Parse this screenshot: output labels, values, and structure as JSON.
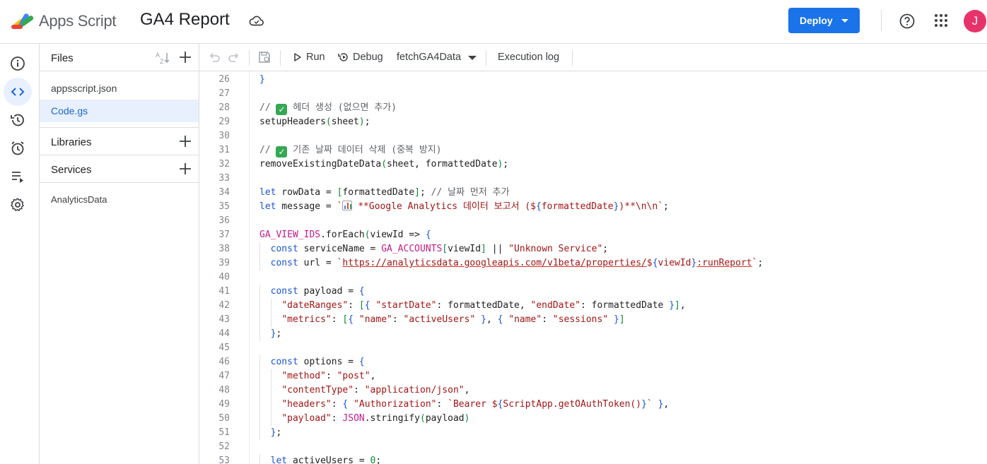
{
  "header": {
    "app_name": "Apps Script",
    "project_name": "GA4 Report",
    "deploy_label": "Deploy",
    "avatar_letter": "J"
  },
  "rail": {
    "items": [
      "overview",
      "editor",
      "executions-history",
      "triggers",
      "executions",
      "project-settings"
    ]
  },
  "files_panel": {
    "files_title": "Files",
    "files": [
      {
        "name": "appsscript.json",
        "active": false
      },
      {
        "name": "Code.gs",
        "active": true
      }
    ],
    "libraries_title": "Libraries",
    "services_title": "Services",
    "services": [
      "AnalyticsData"
    ]
  },
  "toolbar": {
    "run_label": "Run",
    "debug_label": "Debug",
    "function_name": "fetchGA4Data",
    "execution_log_label": "Execution log"
  },
  "editor": {
    "lines": [
      {
        "n": "26",
        "text": "}"
      },
      {
        "n": "27",
        "text": ""
      },
      {
        "n": "28",
        "text": "// ✅ 헤더 생성 (없으면 추가)"
      },
      {
        "n": "29",
        "text": "setupHeaders(sheet);"
      },
      {
        "n": "30",
        "text": ""
      },
      {
        "n": "31",
        "text": "// ✅ 기존 날짜 데이터 삭제 (중복 방지)"
      },
      {
        "n": "32",
        "text": "removeExistingDateData(sheet, formattedDate);"
      },
      {
        "n": "33",
        "text": ""
      },
      {
        "n": "34",
        "text": "let rowData = [formattedDate]; // 날짜 먼저 추가"
      },
      {
        "n": "35",
        "text": "let message = `📊 **Google Analytics 데이터 보고서 (${formattedDate})**\\n\\n`;"
      },
      {
        "n": "36",
        "text": ""
      },
      {
        "n": "37",
        "text": "GA_VIEW_IDS.forEach(viewId => {"
      },
      {
        "n": "38",
        "text": "  const serviceName = GA_ACCOUNTS[viewId] || \"Unknown Service\";"
      },
      {
        "n": "39",
        "text": "  const url = `https://analyticsdata.googleapis.com/v1beta/properties/${viewId}:runReport`;"
      },
      {
        "n": "40",
        "text": ""
      },
      {
        "n": "41",
        "text": "  const payload = {"
      },
      {
        "n": "42",
        "text": "    \"dateRanges\": [{ \"startDate\": formattedDate, \"endDate\": formattedDate }],"
      },
      {
        "n": "43",
        "text": "    \"metrics\": [{ \"name\": \"activeUsers\" }, { \"name\": \"sessions\" }]"
      },
      {
        "n": "44",
        "text": "  };"
      },
      {
        "n": "45",
        "text": ""
      },
      {
        "n": "46",
        "text": "  const options = {"
      },
      {
        "n": "47",
        "text": "    \"method\": \"post\","
      },
      {
        "n": "48",
        "text": "    \"contentType\": \"application/json\","
      },
      {
        "n": "49",
        "text": "    \"headers\": { \"Authorization\": `Bearer ${ScriptApp.getOAuthToken()}` },"
      },
      {
        "n": "50",
        "text": "    \"payload\": JSON.stringify(payload)"
      },
      {
        "n": "51",
        "text": "  };"
      },
      {
        "n": "52",
        "text": ""
      },
      {
        "n": "53",
        "text": "  let activeUsers = 0;"
      }
    ]
  },
  "colors": {
    "accent": "#1a73e8",
    "active_bg": "#e8f0fe",
    "avatar": "#e8336a",
    "string": "#a31515",
    "keyword": "#1a55d4",
    "constant": "#c41a8a"
  }
}
